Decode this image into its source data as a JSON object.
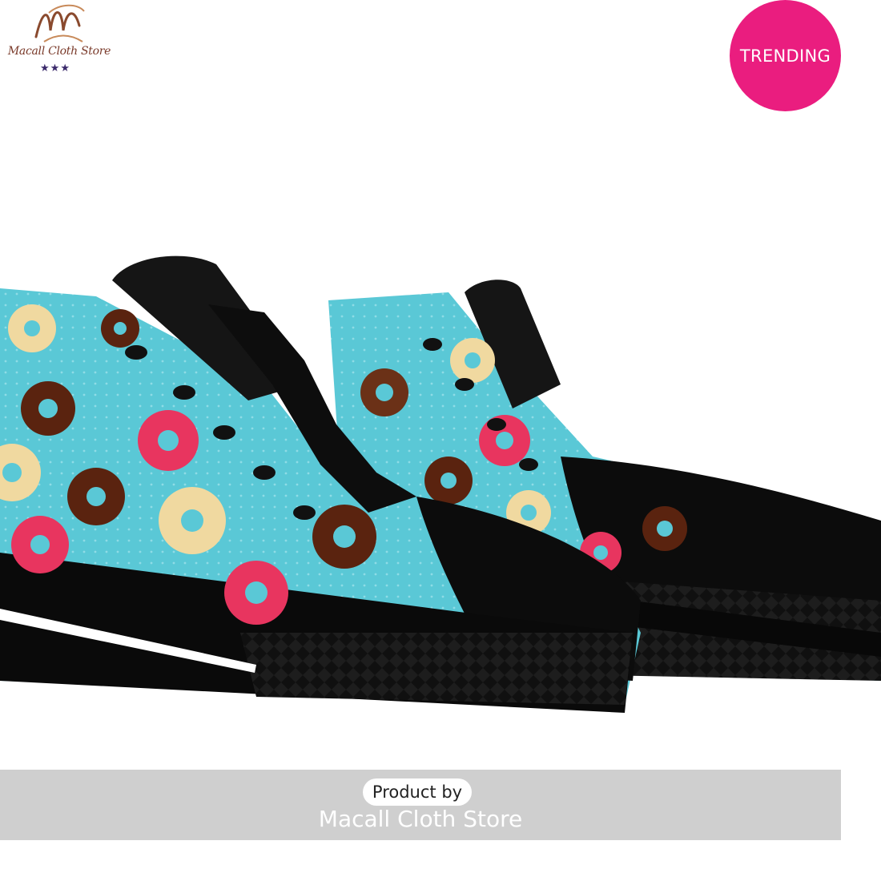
{
  "logo": {
    "name": "Macall Cloth Store",
    "stars": "★★★",
    "monogram": "M"
  },
  "badge": {
    "label": "TRENDING",
    "color": "#ea1d7f"
  },
  "banner": {
    "pill_label": "Product by",
    "store_name": "Macall Cloth Store"
  },
  "product": {
    "image": "donut-pattern-high-top-sneakers",
    "colors": {
      "upper": "#5ac8d6",
      "sole": "#0b0b0b",
      "accent": "#ea1d7f"
    }
  }
}
